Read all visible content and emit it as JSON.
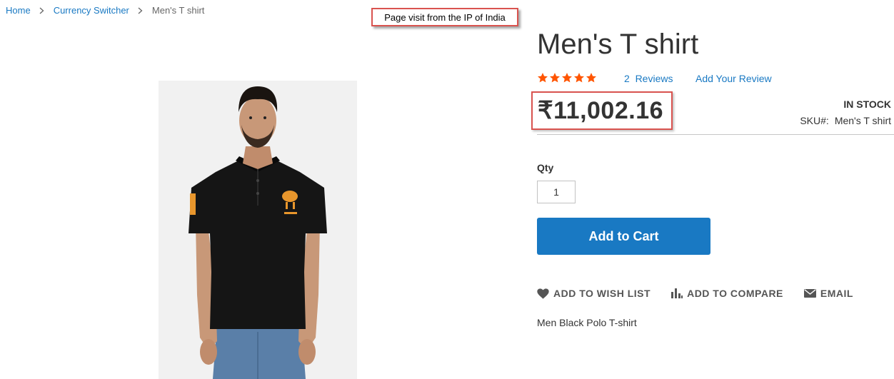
{
  "breadcrumb": {
    "items": [
      "Home",
      "Currency Switcher"
    ],
    "current": "Men's T shirt"
  },
  "annotation": {
    "text": "Page visit from the IP of India"
  },
  "product": {
    "title": "Men's T shirt",
    "rating": {
      "stars": 5,
      "reviews_label": "2  Reviews",
      "add_review_label": "Add Your Review"
    },
    "price": "₹11,002.16",
    "stock": "IN STOCK",
    "sku_label": "SKU#:",
    "sku_value": "Men's T shirt",
    "qty_label": "Qty",
    "qty_value": "1",
    "add_to_cart_label": "Add to Cart",
    "actions": {
      "wishlist": "ADD TO WISH LIST",
      "compare": "ADD TO COMPARE",
      "email": "EMAIL"
    },
    "description": "Men Black Polo T-shirt"
  },
  "colors": {
    "link": "#1979c3",
    "button": "#1979c3",
    "star": "#ff5501",
    "highlight": "#d9534f"
  },
  "icons": {
    "breadcrumb_separator": "chevron-right-icon",
    "wishlist": "heart-icon",
    "compare": "bar-chart-icon",
    "email": "envelope-icon",
    "rating": "star-icon"
  }
}
